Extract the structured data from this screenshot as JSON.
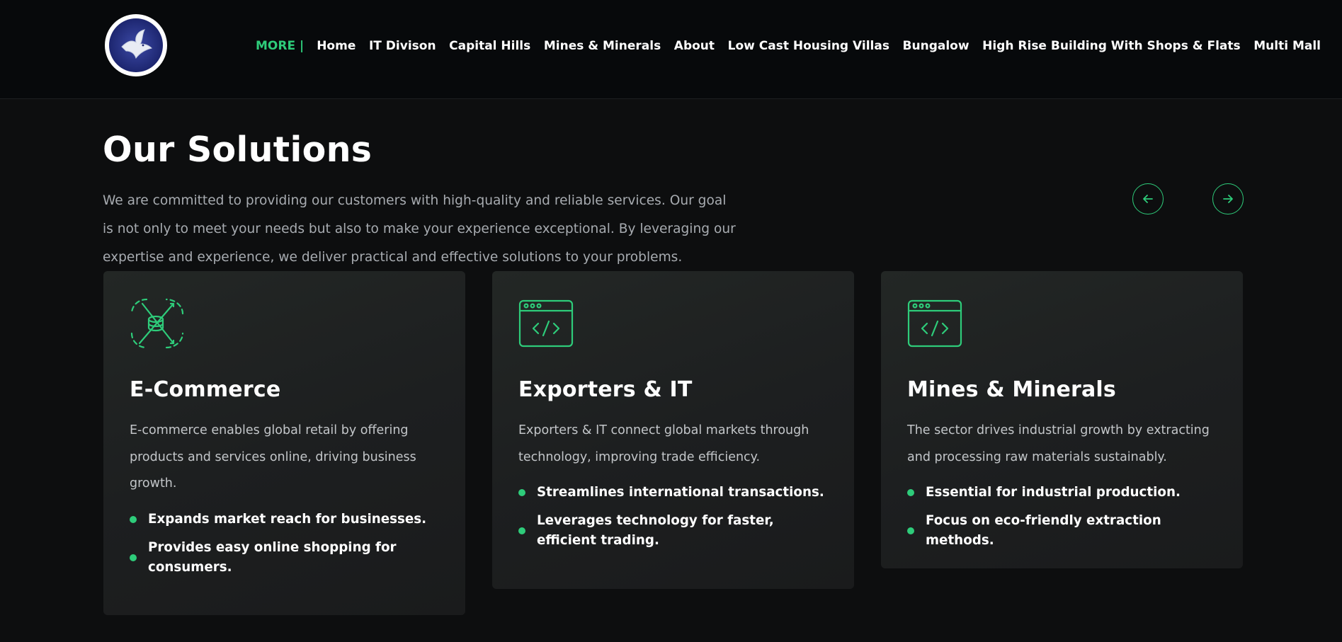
{
  "header": {
    "nav_more": "MORE |",
    "nav_items": [
      "Home",
      "IT Divison",
      "Capital Hills",
      "Mines & Minerals",
      "About",
      "Low Cast Housing Villas",
      "Bungalow",
      "High Rise Building With Shops & Flats",
      "Multi Mall"
    ]
  },
  "hero": {
    "title": "Our Solutions",
    "description": "We are committed to providing our customers with high-quality and reliable services. Our goal is not only to meet your needs but also to make your experience exceptional. By leveraging our expertise and experience, we deliver practical and effective solutions to your problems."
  },
  "cards": [
    {
      "icon": "database-cycle-icon",
      "title": "E-Commerce",
      "text": "E-commerce enables global retail by offering products and services online, driving business growth.",
      "bullets": [
        "Expands market reach for businesses.",
        "Provides easy online shopping for consumers."
      ]
    },
    {
      "icon": "code-window-icon",
      "title": "Exporters & IT",
      "text": "Exporters & IT connect global markets through technology, improving trade efficiency.",
      "bullets": [
        "Streamlines international transactions.",
        "Leverages technology for faster, efficient trading."
      ]
    },
    {
      "icon": "code-window-icon",
      "title": "Mines & Minerals",
      "text": "The sector drives industrial growth by extracting and processing raw materials sustainably.",
      "bullets": [
        "Essential for industrial production.",
        "Focus on eco-friendly extraction methods."
      ]
    }
  ],
  "colors": {
    "accent": "#2ecc7a",
    "background": "#0d0e0f",
    "header_bg": "#07090b",
    "card_bg": "#1e2021"
  }
}
